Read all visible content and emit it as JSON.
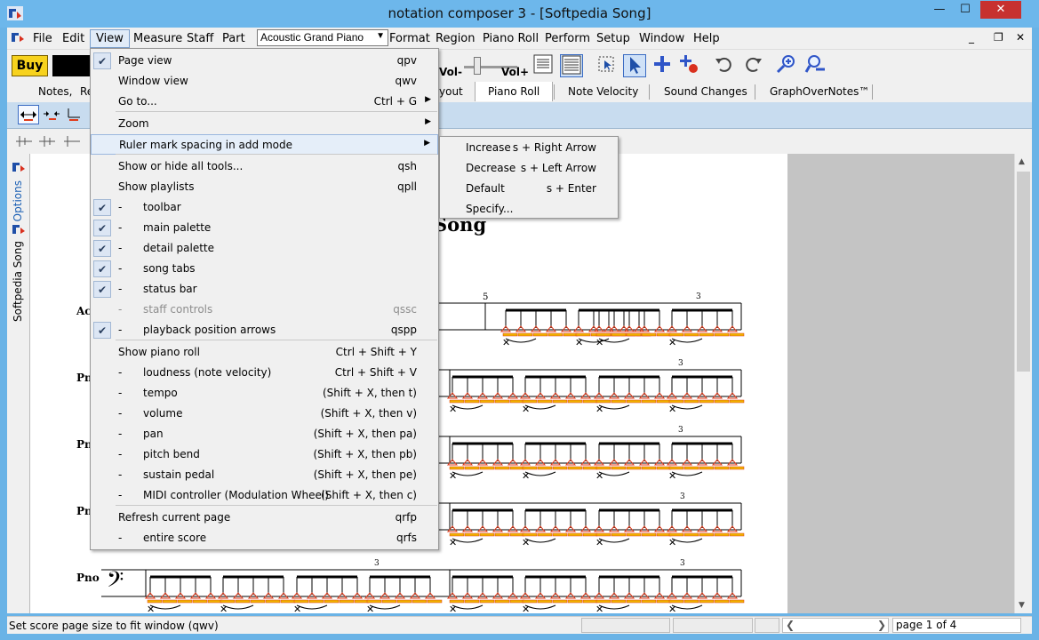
{
  "window": {
    "title": "notation composer 3 - [Softpedia Song]",
    "minimize": "—",
    "maximize": "☐",
    "close": "✕"
  },
  "menubar": {
    "items": [
      "File",
      "Edit",
      "View",
      "Measure",
      "Staff",
      "Part",
      "Format",
      "Region",
      "Piano Roll",
      "Perform",
      "Setup",
      "Window",
      "Help"
    ],
    "instrument": "Acoustic Grand Piano",
    "mdi_min": "_",
    "mdi_restore": "❐",
    "mdi_close": "✕"
  },
  "toolbar": {
    "buy": "Buy",
    "vol_minus": "Vol-",
    "vol_plus": "Vol+",
    "volume_level": 0.25
  },
  "tabs": {
    "left_partial_1": "Notes,",
    "left_partial_2": "Re",
    "items": [
      "yout",
      "Piano Roll",
      "Note Velocity",
      "Sound Changes",
      "GraphOverNotes™"
    ]
  },
  "sidebar": {
    "tab_options": "Options",
    "tab_song": "Softpedia Song"
  },
  "score": {
    "title": "Song",
    "labels": [
      "Ac",
      "Pn",
      "Pn",
      "Pn",
      "Pno"
    ],
    "bar_number": "5",
    "triplet": "3"
  },
  "view_menu": {
    "items": [
      {
        "label": "Page view",
        "shortcut": "qpv",
        "checked": true
      },
      {
        "label": "Window view",
        "shortcut": "qwv"
      },
      {
        "label": "Go to...",
        "shortcut": "Ctrl + G",
        "submenu": true
      },
      {
        "label": "Zoom",
        "submenu": true
      },
      {
        "label": "Ruler mark spacing in add mode",
        "submenu": true,
        "highlighted": true
      },
      {
        "label": "Show or hide all tools...",
        "shortcut": "qsh"
      },
      {
        "label": "Show playlists",
        "shortcut": "qpll"
      },
      {
        "label": "toolbar",
        "dash": "-",
        "checked": true
      },
      {
        "label": "main palette",
        "dash": "-",
        "checked": true
      },
      {
        "label": "detail palette",
        "dash": "-",
        "checked": true
      },
      {
        "label": "song tabs",
        "dash": "-",
        "checked": true
      },
      {
        "label": "status bar",
        "dash": "-",
        "checked": true
      },
      {
        "label": "staff controls",
        "dash": "-",
        "shortcut": "qssc",
        "disabled": true
      },
      {
        "label": "playback position arrows",
        "dash": "-",
        "shortcut": "qspp",
        "checked": true
      },
      {
        "label": "Show piano roll",
        "shortcut": "Ctrl + Shift + Y"
      },
      {
        "label": "loudness (note velocity)",
        "dash": "-",
        "shortcut": "Ctrl + Shift + V"
      },
      {
        "label": "tempo",
        "dash": "-",
        "shortcut": "(Shift + X, then t)"
      },
      {
        "label": "volume",
        "dash": "-",
        "shortcut": "(Shift + X, then v)"
      },
      {
        "label": "pan",
        "dash": "-",
        "shortcut": "(Shift + X, then pa)"
      },
      {
        "label": "pitch bend",
        "dash": "-",
        "shortcut": "(Shift + X, then pb)"
      },
      {
        "label": "sustain pedal",
        "dash": "-",
        "shortcut": "(Shift + X, then pe)"
      },
      {
        "label": "MIDI controller (Modulation Wheel)",
        "dash": "-",
        "shortcut": "(Shift + X, then c)"
      },
      {
        "label": "Refresh current page",
        "shortcut": "qrfp"
      },
      {
        "label": "entire score",
        "dash": "-",
        "shortcut": "qrfs"
      }
    ],
    "check_mark": "✔",
    "submenu_arrow": "▶"
  },
  "ruler_submenu": {
    "items": [
      {
        "label": "Increase",
        "shortcut": "s + Right Arrow"
      },
      {
        "label": "Decrease",
        "shortcut": "s + Left Arrow"
      },
      {
        "label": "Default",
        "shortcut": "s + Enter"
      },
      {
        "label": "Specify...",
        "shortcut": ""
      }
    ]
  },
  "statusbar": {
    "text": "Set score page size to fit window (qwv)",
    "page": "page 1 of 4",
    "left_arrow": "❮",
    "right_arrow": "❯"
  },
  "colors": {
    "titlebar": "#6db7eb",
    "buy": "#f7d21d",
    "close": "#c7312f",
    "palette_bg": "#c8dcef",
    "note_red": "#e03a1a",
    "note_yellow": "#f0b400"
  },
  "icons": [
    "app-icon",
    "page-view-icon",
    "window-view-icon",
    "select-region-icon",
    "arrow-pointer-icon",
    "add-note-icon",
    "add-record-icon",
    "undo-icon",
    "redo-icon",
    "zoom-in-icon",
    "zoom-out-icon"
  ]
}
